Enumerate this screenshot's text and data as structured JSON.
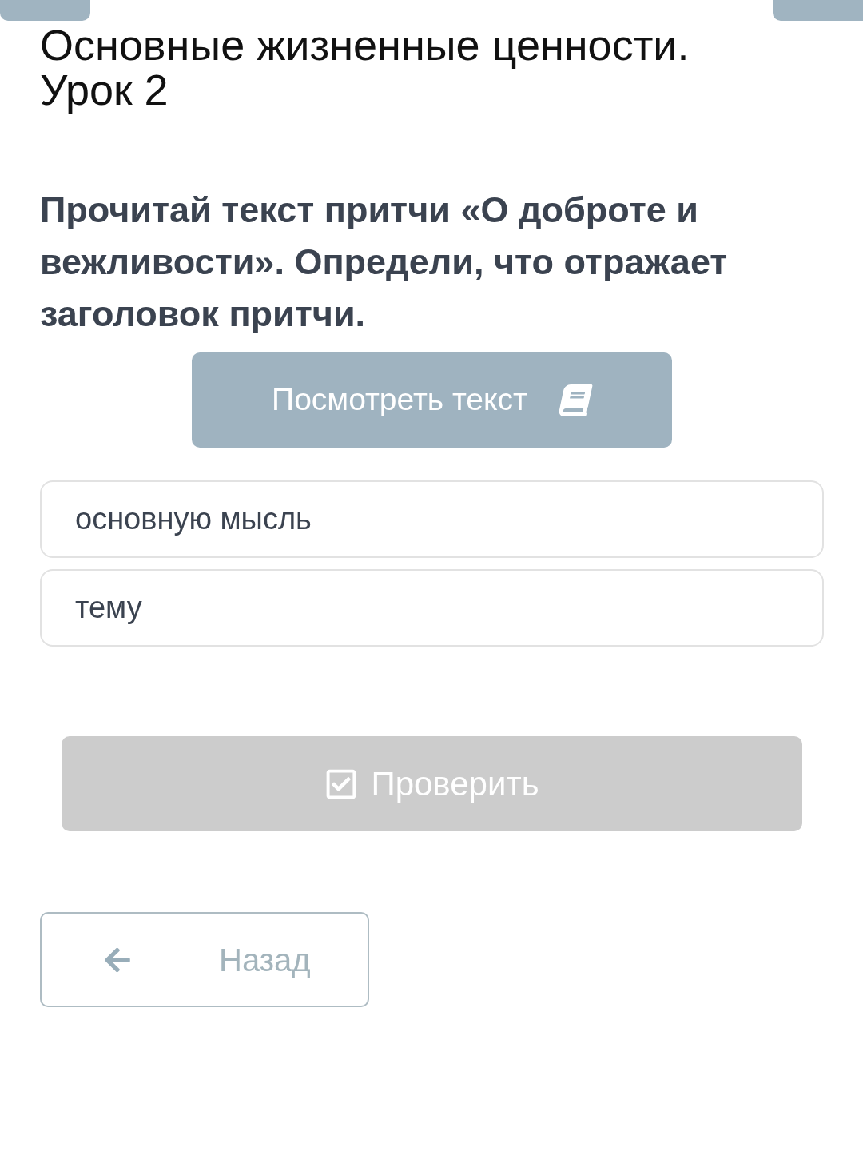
{
  "lesson_title": "Основные жизненные ценности. Урок 2",
  "question": "Прочитай текст притчи «О доброте и вежливости». Определи, что отражает заголовок притчи.",
  "view_text_button": {
    "label": "Посмотреть текст"
  },
  "options": [
    {
      "label": "основную мысль",
      "selected": false
    },
    {
      "label": "тему",
      "selected": false
    }
  ],
  "check_button": {
    "label": "Проверить",
    "disabled": true
  },
  "back_button": {
    "label": "Назад"
  }
}
